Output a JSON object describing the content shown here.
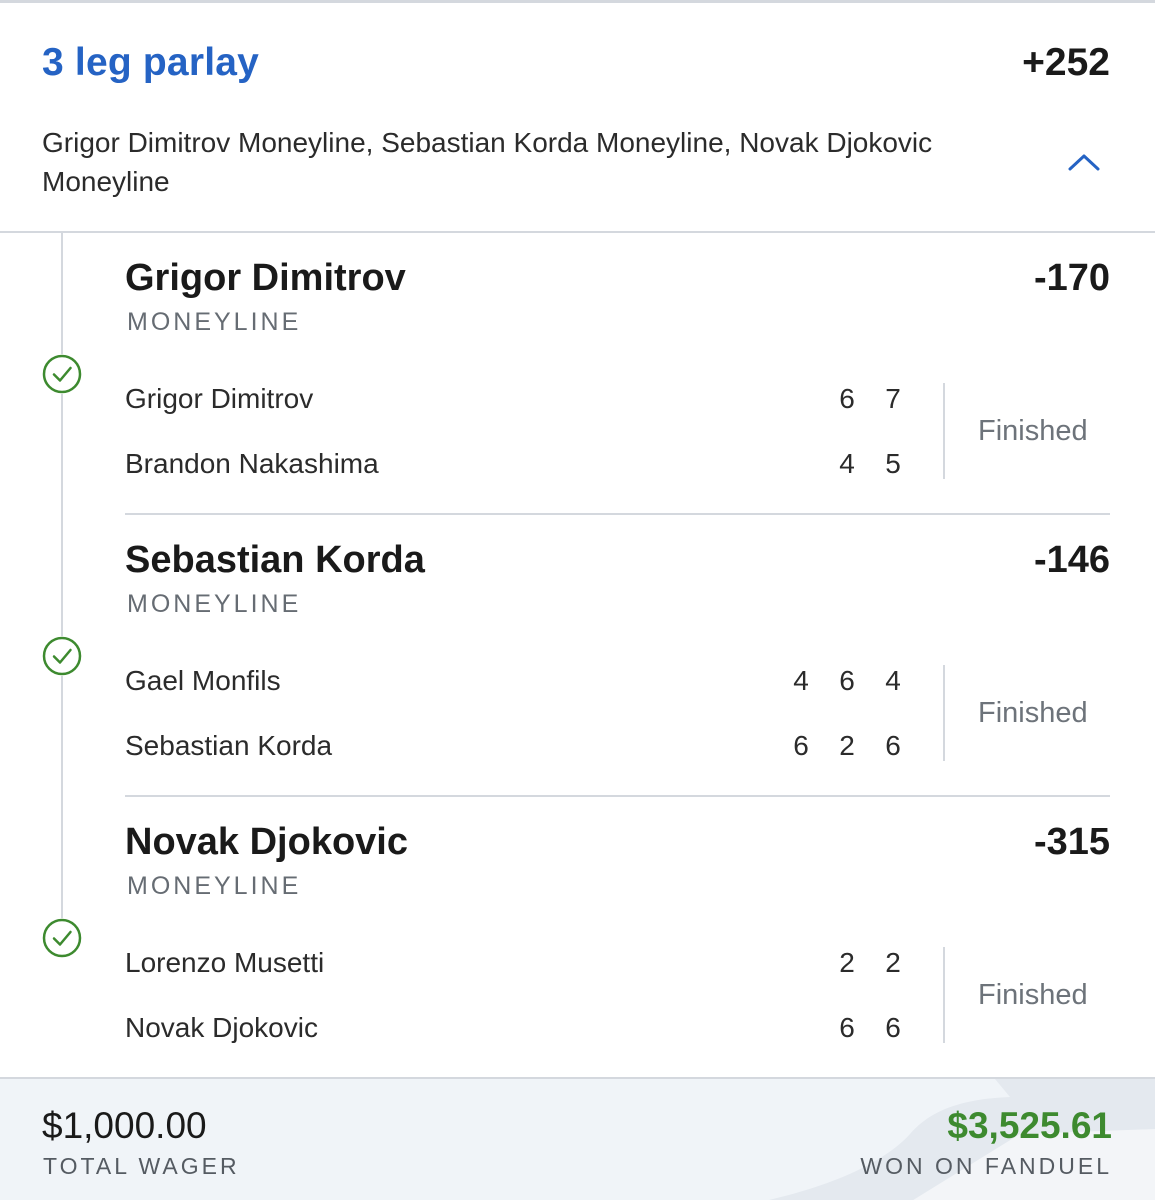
{
  "parlay": {
    "title": "3 leg parlay",
    "odds": "+252",
    "summary": "Grigor Dimitrov Moneyline, Sebastian Korda Moneyline, Novak Djokovic Moneyline",
    "collapse_icon": "chevron-up-icon"
  },
  "legs": [
    {
      "selection": "Grigor Dimitrov",
      "market": "MONEYLINE",
      "odds": "-170",
      "status": "Finished",
      "result_icon": "check-circle-icon",
      "players": [
        {
          "name": "Grigor Dimitrov",
          "sets": [
            "6",
            "7"
          ]
        },
        {
          "name": "Brandon Nakashima",
          "sets": [
            "4",
            "5"
          ]
        }
      ]
    },
    {
      "selection": "Sebastian Korda",
      "market": "MONEYLINE",
      "odds": "-146",
      "status": "Finished",
      "result_icon": "check-circle-icon",
      "players": [
        {
          "name": "Gael Monfils",
          "sets": [
            "4",
            "6",
            "4"
          ]
        },
        {
          "name": "Sebastian Korda",
          "sets": [
            "6",
            "2",
            "6"
          ]
        }
      ]
    },
    {
      "selection": "Novak Djokovic",
      "market": "MONEYLINE",
      "odds": "-315",
      "status": "Finished",
      "result_icon": "check-circle-icon",
      "players": [
        {
          "name": "Lorenzo Musetti",
          "sets": [
            "2",
            "2"
          ]
        },
        {
          "name": "Novak Djokovic",
          "sets": [
            "6",
            "6"
          ]
        }
      ]
    }
  ],
  "footer": {
    "wager_amount": "$1,000.00",
    "wager_label": "TOTAL WAGER",
    "won_amount": "$3,525.61",
    "won_label": "WON ON FANDUEL"
  },
  "colors": {
    "accent": "#2563c4",
    "win": "#3d8a2f",
    "divider": "#d4d8de",
    "footer_bg": "#f0f4f8"
  }
}
